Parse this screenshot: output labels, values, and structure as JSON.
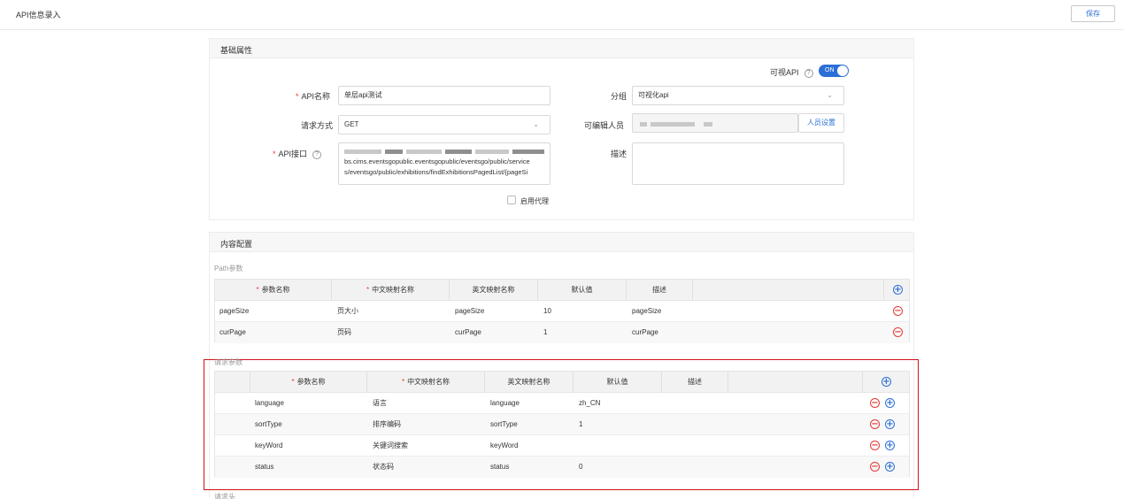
{
  "header": {
    "title": "API信息录入",
    "save_label": "保存"
  },
  "basic": {
    "title": "基础属性",
    "visual_api_label": "可视API",
    "toggle_label": "ON",
    "api_name_label": "API名称",
    "api_name_value": "单层api测试",
    "group_label": "分组",
    "group_value": "可视化api",
    "method_label": "请求方式",
    "method_value": "GET",
    "editors_label": "可编辑人员",
    "editors_button": "人员设置",
    "api_endpoint_label": "API接口",
    "api_endpoint_lines": [
      "bs.cims.eventsgopublic.eventsgopublic/eventsgo/public/service",
      "s/eventsgo/public/exhibitions/findExhibitionsPagedList/{pageSi"
    ],
    "desc_label": "描述",
    "proxy_label": "启用代理"
  },
  "content": {
    "title": "内容配置",
    "path_params_label": "Path参数",
    "path_columns": [
      "参数名称",
      "中文映射名称",
      "英文映射名称",
      "默认值",
      "描述"
    ],
    "path_rows": [
      {
        "name": "pageSize",
        "cn": "页大小",
        "en": "pageSize",
        "default": "10",
        "desc": "pageSize"
      },
      {
        "name": "curPage",
        "cn": "页码",
        "en": "curPage",
        "default": "1",
        "desc": "curPage"
      }
    ],
    "req_params_label": "请求参数",
    "req_columns": [
      "参数名称",
      "中文映射名称",
      "英文映射名称",
      "默认值",
      "描述"
    ],
    "req_rows": [
      {
        "name": "language",
        "cn": "语言",
        "en": "language",
        "default": "zh_CN"
      },
      {
        "name": "sortType",
        "cn": "排序编码",
        "en": "sortType",
        "default": "1"
      },
      {
        "name": "keyWord",
        "cn": "关键词搜索",
        "en": "keyWord",
        "default": ""
      },
      {
        "name": "status",
        "cn": "状态码",
        "en": "status",
        "default": "0"
      }
    ],
    "req_headers_label": "请求头"
  },
  "colors": {
    "accent": "#2b6fd6",
    "danger": "#e53935",
    "highlight_border": "#d0101a"
  }
}
